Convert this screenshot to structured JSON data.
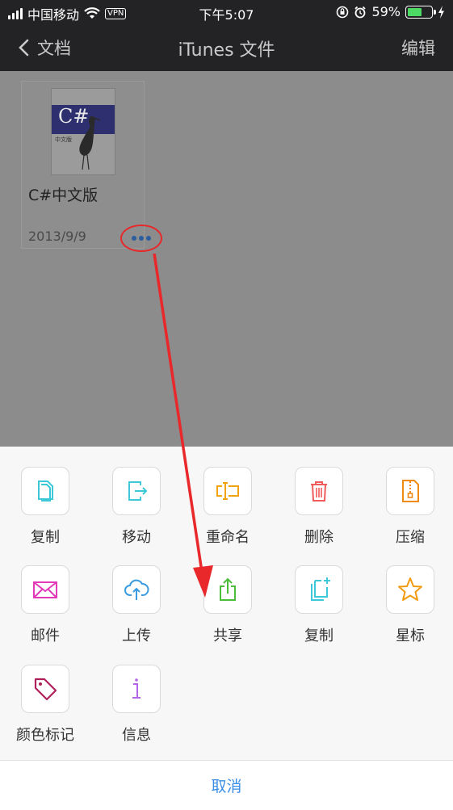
{
  "status_bar": {
    "carrier": "中国移动",
    "vpn": "VPN",
    "time": "下午5:07",
    "battery": "59%",
    "battery_level": 0.59
  },
  "nav": {
    "back_label": "文档",
    "title": "iTunes 文件",
    "edit_label": "编辑"
  },
  "file": {
    "thumb_title": "C#",
    "thumb_sub": "中文版",
    "name": "C#中文版",
    "date": "2013/9/9"
  },
  "actions": [
    {
      "label": "复制",
      "icon": "copy-icon"
    },
    {
      "label": "移动",
      "icon": "move-icon"
    },
    {
      "label": "重命名",
      "icon": "rename-icon"
    },
    {
      "label": "删除",
      "icon": "trash-icon"
    },
    {
      "label": "压缩",
      "icon": "zip-icon"
    },
    {
      "label": "邮件",
      "icon": "mail-icon"
    },
    {
      "label": "上传",
      "icon": "cloud-upload-icon"
    },
    {
      "label": "共享",
      "icon": "share-icon"
    },
    {
      "label": "复制",
      "icon": "duplicate-icon"
    },
    {
      "label": "星标",
      "icon": "star-icon"
    },
    {
      "label": "颜色标记",
      "icon": "tag-icon"
    },
    {
      "label": "信息",
      "icon": "info-icon"
    }
  ],
  "cancel_label": "取消",
  "colors": {
    "accent": "#3a8ee6",
    "annotation": "#e8282a",
    "copy": "#3cc8d8",
    "rename": "#f2a20e",
    "delete": "#f05a5a",
    "zip": "#f08a12",
    "mail": "#e23ab9",
    "share": "#4cbd3a",
    "star": "#f29a12",
    "tag": "#b0205a",
    "info": "#b464e8"
  }
}
